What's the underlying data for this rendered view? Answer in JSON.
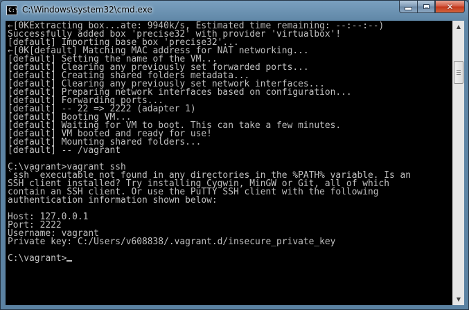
{
  "window": {
    "title": "C:\\Windows\\system32\\cmd.exe",
    "icon": "cmd-icon",
    "icon_glyph": "C:\\",
    "buttons": {
      "minimize": "minimize-icon",
      "maximize": "maximize-icon",
      "close_glyph": "✕"
    }
  },
  "console": {
    "text_color": "#c0c0c0",
    "background": "#000000",
    "lines": [
      "←[0KExtracting box...ate: 9940k/s, Estimated time remaining: --:--:--)",
      "Successfully added box 'precise32' with provider 'virtualbox'!",
      "[default] Importing base box 'precise32'...",
      "←[0K[default] Matching MAC address for NAT networking...",
      "[default] Setting the name of the VM...",
      "[default] Clearing any previously set forwarded ports...",
      "[default] Creating shared folders metadata...",
      "[default] Clearing any previously set network interfaces...",
      "[default] Preparing network interfaces based on configuration...",
      "[default] Forwarding ports...",
      "[default] -- 22 => 2222 (adapter 1)",
      "[default] Booting VM...",
      "[default] Waiting for VM to boot. This can take a few minutes.",
      "[default] VM booted and ready for use!",
      "[default] Mounting shared folders...",
      "[default] -- /vagrant",
      "",
      "C:\\vagrant>vagrant ssh",
      "`ssh` executable not found in any directories in the %PATH% variable. Is an",
      "SSH client installed? Try installing Cygwin, MinGW or Git, all of which",
      "contain an SSH client. Or use the PuTTY SSH client with the following",
      "authentication information shown below:",
      "",
      "Host: 127.0.0.1",
      "Port: 2222",
      "Username: vagrant",
      "Private key: C:/Users/v608838/.vagrant.d/insecure_private_key",
      ""
    ],
    "prompt": "C:\\vagrant>"
  },
  "scrollbar": {
    "up_glyph": "▲",
    "down_glyph": "▼",
    "position": 0.12
  }
}
